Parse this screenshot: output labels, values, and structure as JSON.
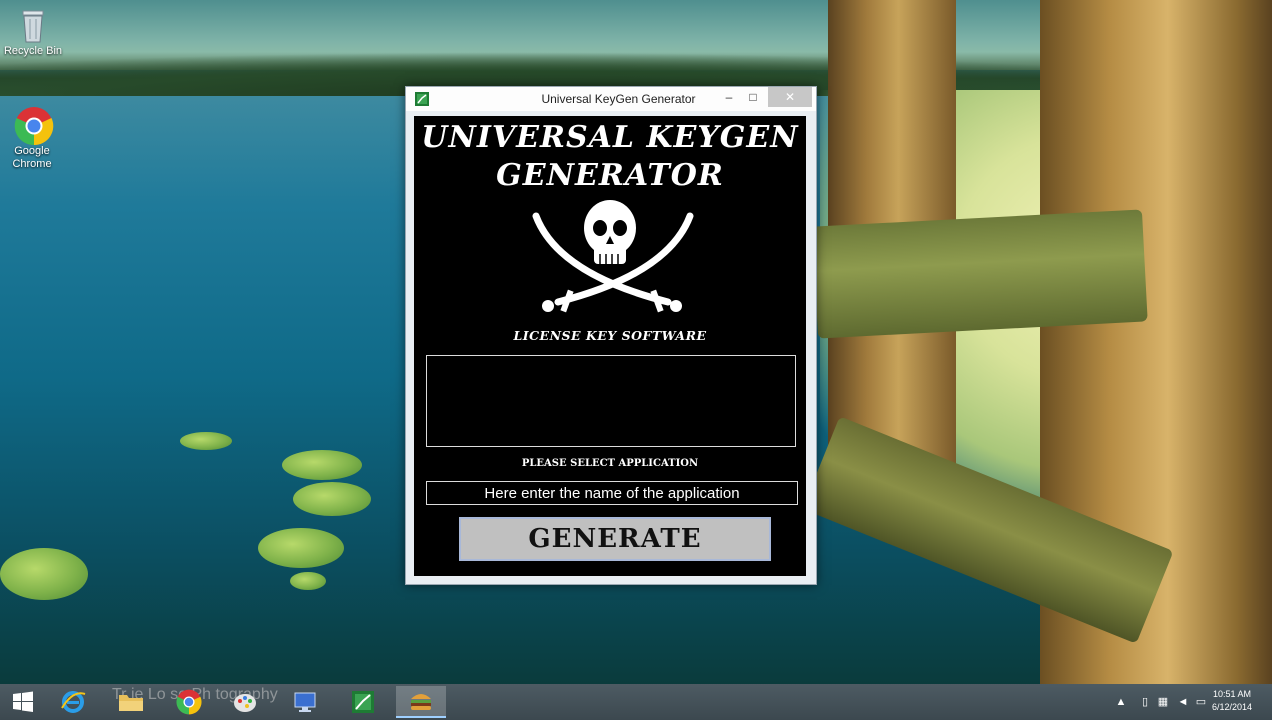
{
  "desktop": {
    "icons": [
      {
        "label": "Recycle Bin"
      },
      {
        "label": "Google Chrome"
      }
    ],
    "watermark": "Tr   ie Lo   se Ph   tography"
  },
  "window": {
    "title": "Universal KeyGen Generator",
    "controls": {
      "minimize": "–",
      "maximize": "□",
      "close": "✕"
    },
    "heading_line1": "UNIVERSAL KEYGEN",
    "heading_line2": "GENERATOR",
    "subtitle": "LICENSE KEY SOFTWARE",
    "output_value": "",
    "select_label": "PLEASE SELECT APPLICATION",
    "app_input_value": "Here enter the name of the application",
    "generate_label": "GENERATE",
    "logo_icon": "skull-crossed-swords-icon"
  },
  "taskbar": {
    "items": [
      {
        "name": "start-button",
        "icon": "windows-logo-icon"
      },
      {
        "name": "internet-explorer",
        "icon": "ie-icon"
      },
      {
        "name": "file-explorer",
        "icon": "folder-icon"
      },
      {
        "name": "chrome",
        "icon": "chrome-icon"
      },
      {
        "name": "paint",
        "icon": "paint-icon"
      },
      {
        "name": "remote-desktop",
        "icon": "monitor-icon"
      },
      {
        "name": "keygen-app",
        "icon": "spreadsheet-icon"
      },
      {
        "name": "keygen-running",
        "icon": "burger-icon"
      }
    ],
    "clock_time": "10:51 AM",
    "clock_date": "6/12/2014"
  },
  "colors": {
    "window_client": "#000000",
    "button_face": "#c0c0c0",
    "taskbar": "#3c484f"
  }
}
